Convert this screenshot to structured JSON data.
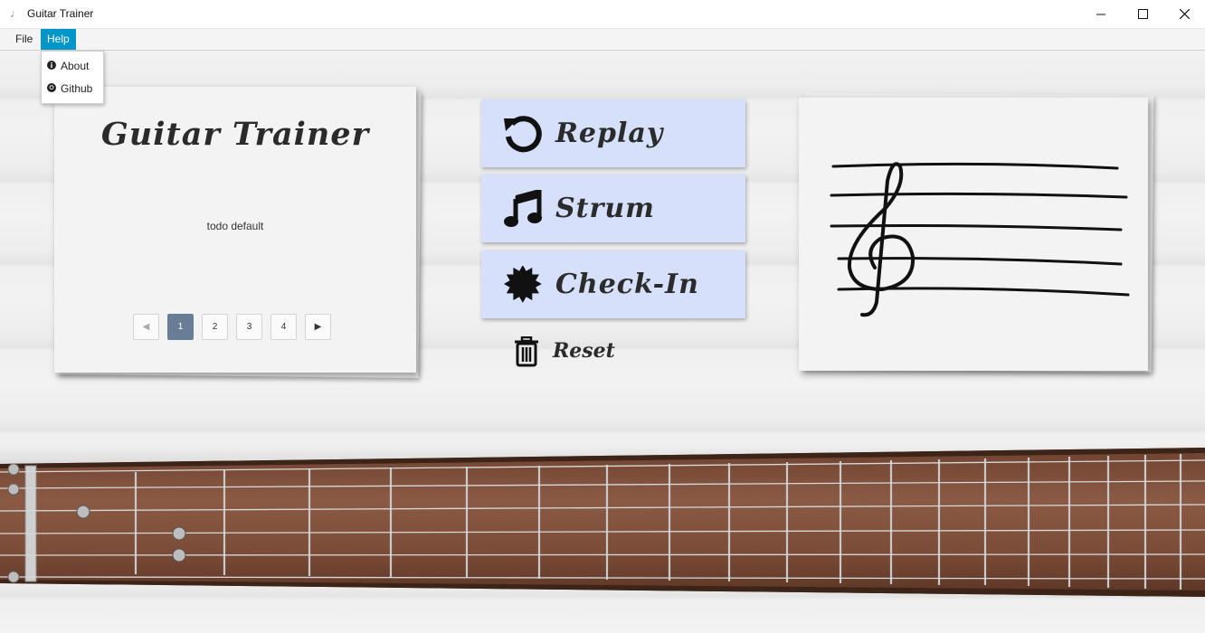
{
  "window": {
    "title": "Guitar Trainer"
  },
  "menu": {
    "file": "File",
    "help": "Help"
  },
  "help_menu": {
    "items": [
      {
        "label": "About",
        "icon": "info-icon"
      },
      {
        "label": "Github",
        "icon": "github-icon"
      }
    ]
  },
  "lesson_card": {
    "title": "Guitar Trainer",
    "body": "todo default",
    "pages": [
      "1",
      "2",
      "3",
      "4"
    ],
    "current_page": "1"
  },
  "actions": {
    "replay": "Replay",
    "strum": "Strum",
    "checkin": "Check-In",
    "reset": "Reset"
  },
  "colors": {
    "menu_active": "#0096c9",
    "button_bg": "#d6e0fa",
    "page_selected": "#6a7d97"
  }
}
